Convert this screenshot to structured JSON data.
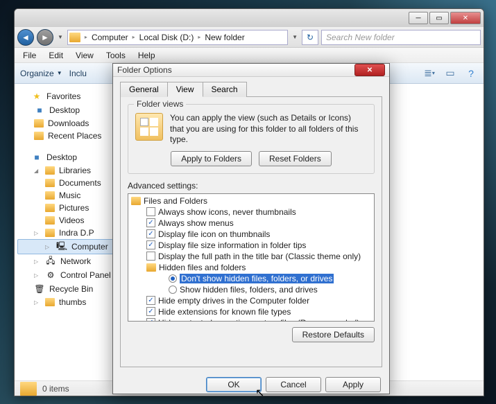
{
  "explorer": {
    "breadcrumb": [
      "Computer",
      "Local Disk (D:)",
      "New folder"
    ],
    "search_placeholder": "Search New folder",
    "menus": [
      "File",
      "Edit",
      "View",
      "Tools",
      "Help"
    ],
    "toolbar": {
      "organize": "Organize",
      "include": "Inclu"
    },
    "sidebar": {
      "favorites": {
        "label": "Favorites",
        "items": [
          "Desktop",
          "Downloads",
          "Recent Places"
        ]
      },
      "desktop": {
        "label": "Desktop",
        "libraries": {
          "label": "Libraries",
          "items": [
            "Documents",
            "Music",
            "Pictures",
            "Videos"
          ]
        },
        "items": [
          "Indra D.P",
          "Computer",
          "Network",
          "Control Panel",
          "Recycle Bin",
          "thumbs"
        ],
        "selected": "Computer"
      }
    },
    "status": {
      "count": "0 items"
    }
  },
  "dialog": {
    "title": "Folder Options",
    "tabs": [
      "General",
      "View",
      "Search"
    ],
    "active_tab": "View",
    "folder_views": {
      "title": "Folder views",
      "text": "You can apply the view (such as Details or Icons) that you are using for this folder to all folders of this type.",
      "apply_btn": "Apply to Folders",
      "reset_btn": "Reset Folders"
    },
    "advanced": {
      "label": "Advanced settings:",
      "root": "Files and Folders",
      "items": [
        {
          "type": "check",
          "checked": false,
          "label": "Always show icons, never thumbnails"
        },
        {
          "type": "check",
          "checked": true,
          "label": "Always show menus"
        },
        {
          "type": "check",
          "checked": true,
          "label": "Display file icon on thumbnails"
        },
        {
          "type": "check",
          "checked": true,
          "label": "Display file size information in folder tips"
        },
        {
          "type": "check",
          "checked": false,
          "label": "Display the full path in the title bar (Classic theme only)"
        },
        {
          "type": "folder",
          "label": "Hidden files and folders"
        },
        {
          "type": "radio",
          "checked": true,
          "selected": true,
          "label": "Don't show hidden files, folders, or drives"
        },
        {
          "type": "radio",
          "checked": false,
          "label": "Show hidden files, folders, and drives"
        },
        {
          "type": "check",
          "checked": true,
          "label": "Hide empty drives in the Computer folder"
        },
        {
          "type": "check",
          "checked": true,
          "label": "Hide extensions for known file types"
        },
        {
          "type": "check",
          "checked": true,
          "label": "Hide protected operating system files (Recommended)"
        }
      ],
      "restore_btn": "Restore Defaults"
    },
    "buttons": {
      "ok": "OK",
      "cancel": "Cancel",
      "apply": "Apply"
    }
  }
}
